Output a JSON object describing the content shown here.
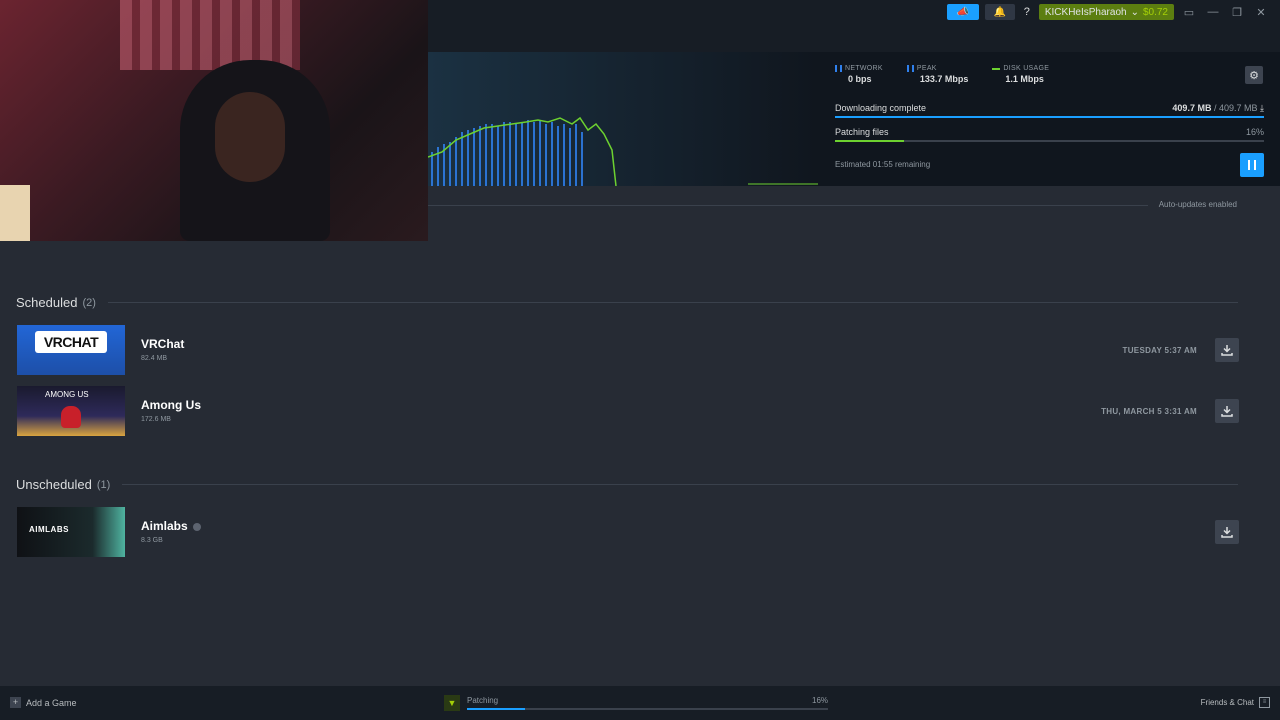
{
  "topbar": {
    "announce_icon": "megaphone-icon",
    "notif_icon": "bell-icon",
    "help_label": "?",
    "account_name": "KICKHeIsPharaoh",
    "account_caret": "⌄",
    "wallet_balance": "$0.72",
    "window_controls": {
      "bigpicture": "▭",
      "minimize": "—",
      "restore": "❐",
      "close": "✕"
    }
  },
  "download": {
    "network_label": "NETWORK",
    "network_value": "0 bps",
    "peak_label": "PEAK",
    "peak_value": "133.7 Mbps",
    "disk_label": "DISK USAGE",
    "disk_value": "1.1 Mbps",
    "status_label": "Downloading complete",
    "downloaded": "409.7 MB",
    "separator": " / ",
    "total": "409.7 MB",
    "download_progress": 1.0,
    "patch_label": "Patching files",
    "patch_pct": "16%",
    "patch_progress": 0.16,
    "eta": "Estimated 01:55 remaining",
    "colors": {
      "accent": "#1a9fff",
      "green": "#6dd130"
    }
  },
  "auto_updates": "Auto-updates enabled",
  "scheduled": {
    "title": "Scheduled",
    "count": "(2)",
    "games": [
      {
        "name": "VRChat",
        "size": "82.4 MB",
        "time": "TUESDAY 5:37 AM",
        "thumb_text": "VRCHAT"
      },
      {
        "name": "Among Us",
        "size": "172.6 MB",
        "time": "THU, MARCH 5 3:31 AM",
        "thumb_text": "AMONG US"
      }
    ]
  },
  "unscheduled": {
    "title": "Unscheduled",
    "count": "(1)",
    "games": [
      {
        "name": "Aimlabs",
        "size": "8.3 GB",
        "thumb_text": "AIMLABS"
      }
    ]
  },
  "bottombar": {
    "add_game": "Add a Game",
    "add_icon": "plus-icon",
    "status": "Patching",
    "pct": "16%",
    "progress": 0.16,
    "friends": "Friends & Chat"
  }
}
